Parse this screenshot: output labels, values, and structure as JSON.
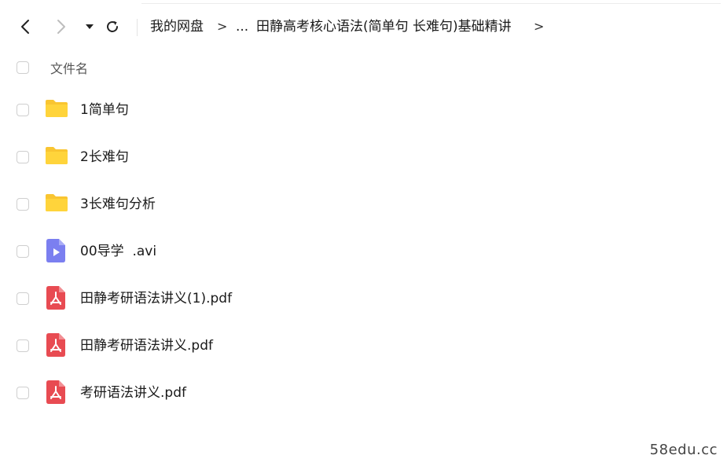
{
  "breadcrumb": {
    "root": "我的网盘",
    "ellipsis": "...",
    "current": "田静高考核心语法(简单句 长难句)基础精讲",
    "separator": ">"
  },
  "list": {
    "header_label": "文件名",
    "items": [
      {
        "name": "1简单句",
        "icon": "folder-icon"
      },
      {
        "name": "2长难句",
        "icon": "folder-icon"
      },
      {
        "name": "3长难句分析",
        "icon": "folder-icon"
      },
      {
        "name": "00导学  .avi",
        "icon": "video-file-icon"
      },
      {
        "name": "田静考研语法讲义(1).pdf",
        "icon": "pdf-file-icon"
      },
      {
        "name": "田静考研语法讲义.pdf",
        "icon": "pdf-file-icon"
      },
      {
        "name": "考研语法讲义.pdf",
        "icon": "pdf-file-icon"
      }
    ]
  },
  "watermark": "58edu.cc",
  "colors": {
    "folder": "#FFD43B",
    "folder_tab": "#F9C531",
    "video": "#7B7FF0",
    "pdf": "#E84B52"
  }
}
